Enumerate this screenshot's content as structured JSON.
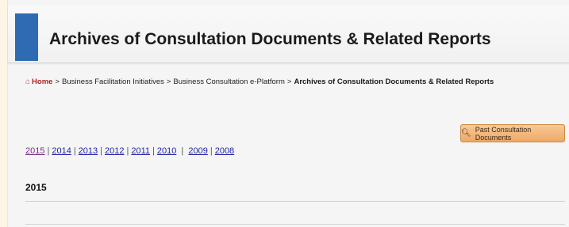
{
  "header": {
    "title": "Archives of Consultation Documents & Related Reports",
    "accent_color": "#2f6bb3"
  },
  "breadcrumb": {
    "home_icon": "home-icon",
    "items": [
      "Home",
      "Business Facilitation Initiatives",
      "Business Consultation e-Platform",
      "Archives of Consultation Documents & Related Reports"
    ],
    "separator": ">"
  },
  "past_button": {
    "icon": "search-icon",
    "label": "Past Consultation Documents"
  },
  "years": [
    "2015",
    "2014",
    "2013",
    "2012",
    "2011",
    "2010",
    "2009",
    "2008"
  ],
  "section_title": "2015"
}
